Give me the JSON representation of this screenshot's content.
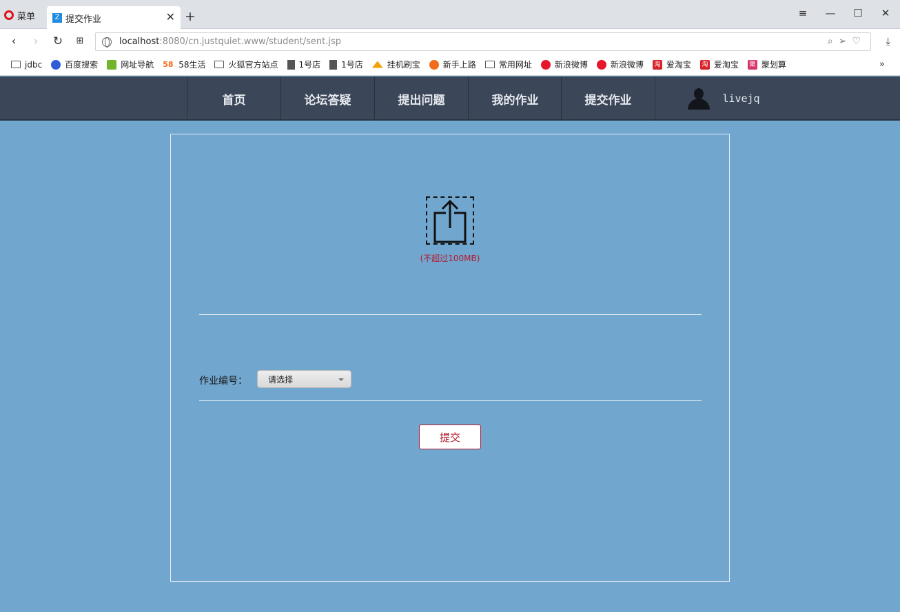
{
  "browser": {
    "menu_label": "菜单",
    "tab_title": "提交作业",
    "url_host": "localhost",
    "url_rest": ":8080/cn.justquiet.www/student/sent.jsp",
    "bookmarks": [
      {
        "icon": "folder-icon",
        "label": "jdbc"
      },
      {
        "icon": "baidu-icon",
        "label": "百度搜索"
      },
      {
        "icon": "hao-icon",
        "label": "网址导航"
      },
      {
        "icon": "58-icon",
        "label": "58生活"
      },
      {
        "icon": "folder-icon",
        "label": "火狐官方站点"
      },
      {
        "icon": "page-icon",
        "label": "1号店"
      },
      {
        "icon": "page-icon",
        "label": "1号店"
      },
      {
        "icon": "pma-icon",
        "label": "挂机刷宝"
      },
      {
        "icon": "firefox-icon",
        "label": "新手上路"
      },
      {
        "icon": "folder-icon",
        "label": "常用网址"
      },
      {
        "icon": "weibo-icon",
        "label": "新浪微博"
      },
      {
        "icon": "weibo-icon",
        "label": "新浪微博"
      },
      {
        "icon": "taobao-icon",
        "label": "爱淘宝"
      },
      {
        "icon": "taobao-icon",
        "label": "爱淘宝"
      },
      {
        "icon": "ju-icon",
        "label": "聚划算"
      }
    ]
  },
  "nav": {
    "items": [
      "首页",
      "论坛答疑",
      "提出问题",
      "我的作业",
      "提交作业"
    ],
    "username": "livejq"
  },
  "form": {
    "upload_hint": "(不超过100MB)",
    "homework_label": "作业编号：",
    "homework_select": "请选择",
    "submit_label": "提交"
  }
}
